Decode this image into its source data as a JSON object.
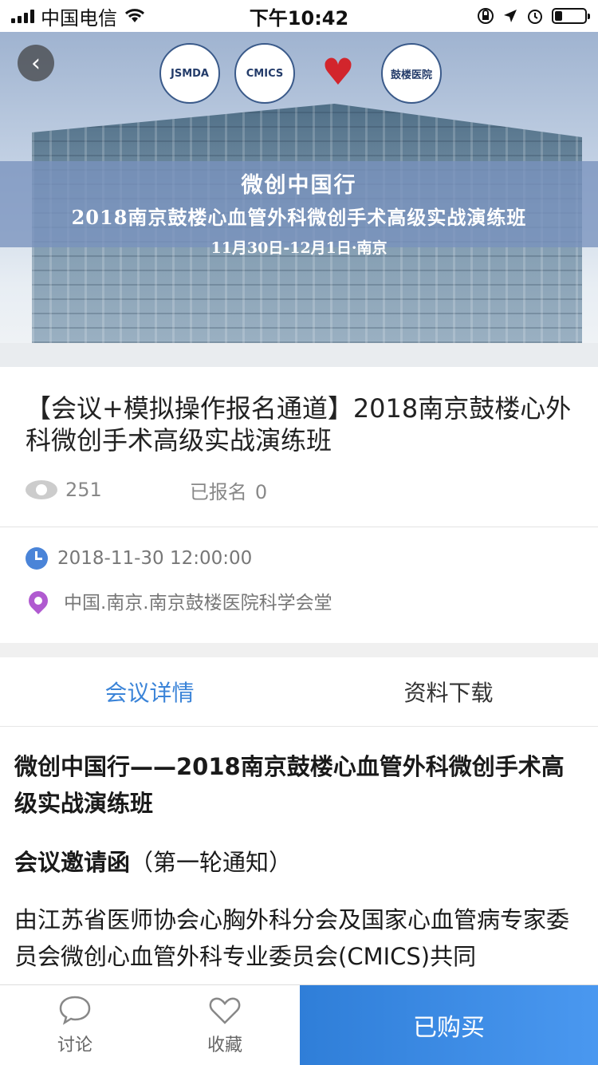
{
  "status_bar": {
    "carrier": "中国电信",
    "time": "下午10:42"
  },
  "hero": {
    "logo1": "JSMDA",
    "logo2": "CMICS",
    "logo4": "鼓楼医院",
    "line1": "微创中国行",
    "line2": "2018南京鼓楼心血管外科微创手术高级实战演练班",
    "line3": "11月30日-12月1日·南京"
  },
  "event": {
    "title": "【会议+模拟操作报名通道】2018南京鼓楼心外科微创手术高级实战演练班",
    "views": "251",
    "registered_label": "已报名",
    "registered_count": "0",
    "datetime": "2018-11-30 12:00:00",
    "location": "中国.南京.南京鼓楼医院科学会堂"
  },
  "tabs": [
    {
      "label": "会议详情",
      "active": true
    },
    {
      "label": "资料下载",
      "active": false
    }
  ],
  "article": {
    "heading": "微创中国行——2018南京鼓楼心血管外科微创手术高级实战演练班",
    "subheading_bold": "会议邀请函",
    "subheading_rest": "（第一轮通知）",
    "body": "由江苏省医师协会心胸外科分会及国家心血管病专家委员会微创心血管外科专业委员会(CMICS)共同"
  },
  "bottom_bar": {
    "discuss_label": "讨论",
    "favorite_label": "收藏",
    "buy_label": "已购买"
  },
  "colors": {
    "accent": "#3b84d8",
    "buy_button": "#2f7ed8",
    "pin": "#b05ad0"
  },
  "icons": {
    "back": "chevron-left-icon",
    "views": "eye-icon",
    "time": "clock-icon",
    "location": "map-pin-icon",
    "discuss": "chat-bubble-icon",
    "favorite": "heart-icon"
  },
  "battery_level": 0.25
}
